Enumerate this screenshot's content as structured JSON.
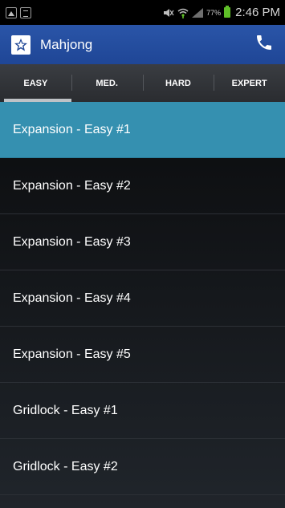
{
  "status_bar": {
    "left_icons": [
      "gallery-icon",
      "document-icon"
    ],
    "battery_percent": "77%",
    "time": "2:46 PM"
  },
  "action_bar": {
    "title": "Mahjong",
    "logo_icon": "mahjong-star-logo",
    "action_icon": "phone-icon"
  },
  "tabs": [
    {
      "label": "EASY",
      "selected": true
    },
    {
      "label": "MED.",
      "selected": false
    },
    {
      "label": "HARD",
      "selected": false
    },
    {
      "label": "EXPERT",
      "selected": false
    }
  ],
  "list": {
    "items": [
      {
        "label": "Expansion - Easy #1",
        "selected": true
      },
      {
        "label": "Expansion - Easy #2",
        "selected": false
      },
      {
        "label": "Expansion - Easy #3",
        "selected": false
      },
      {
        "label": "Expansion - Easy #4",
        "selected": false
      },
      {
        "label": "Expansion - Easy #5",
        "selected": false
      },
      {
        "label": "Gridlock - Easy #1",
        "selected": false
      },
      {
        "label": "Gridlock - Easy #2",
        "selected": false
      }
    ]
  },
  "colors": {
    "action_bar": "#2a55a8",
    "selected_item": "#3590b0",
    "battery": "#5fbf28"
  }
}
